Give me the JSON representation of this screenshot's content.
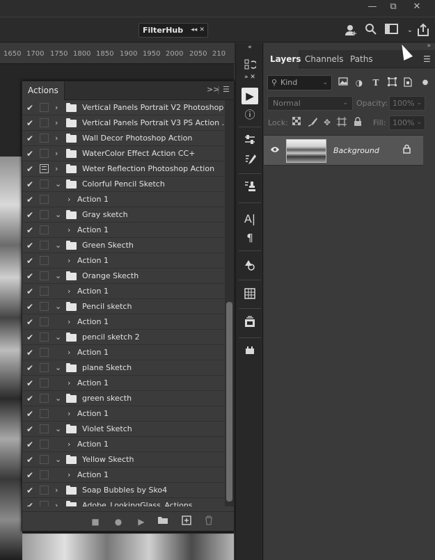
{
  "window": {
    "minimize": "—",
    "restore": "⧉",
    "close": "✕"
  },
  "optionsbar": {
    "filterhub": {
      "label": "FilterHub",
      "controls": "◂◂ ✕"
    },
    "icons": [
      "person-add-icon",
      "search-icon",
      "workspace-icon",
      "share-icon"
    ]
  },
  "ruler": {
    "ticks": [
      "1650",
      "1700",
      "1750",
      "1800",
      "1850",
      "1900",
      "1950",
      "2000",
      "2050",
      "210"
    ]
  },
  "actions": {
    "tab": "Actions",
    "header_icons": {
      "collapse": ">>",
      "menu": "☰"
    },
    "rows": [
      {
        "type": "set",
        "expanded": false,
        "dialog": false,
        "label": "Vertical Panels Portrait V2 Photoshop ..."
      },
      {
        "type": "set",
        "expanded": false,
        "dialog": false,
        "label": "Vertical Panels Portrait V3 PS Action ..."
      },
      {
        "type": "set",
        "expanded": false,
        "dialog": false,
        "label": "Wall Decor Photoshop Action"
      },
      {
        "type": "set",
        "expanded": false,
        "dialog": false,
        "label": "WaterColor Effect Action CC+"
      },
      {
        "type": "set",
        "expanded": false,
        "dialog": true,
        "label": "Weter Reflection Photoshop Action"
      },
      {
        "type": "set",
        "expanded": true,
        "dialog": false,
        "label": "Colorful Pencil Sketch"
      },
      {
        "type": "action",
        "label": "Action 1"
      },
      {
        "type": "set",
        "expanded": true,
        "dialog": false,
        "label": "Gray sketch"
      },
      {
        "type": "action",
        "label": "Action 1"
      },
      {
        "type": "set",
        "expanded": true,
        "dialog": false,
        "label": "Green Skecth"
      },
      {
        "type": "action",
        "label": "Action 1"
      },
      {
        "type": "set",
        "expanded": true,
        "dialog": false,
        "label": "Orange Skecth"
      },
      {
        "type": "action",
        "label": "Action 1"
      },
      {
        "type": "set",
        "expanded": true,
        "dialog": false,
        "label": "Pencil sketch"
      },
      {
        "type": "action",
        "label": "Action 1"
      },
      {
        "type": "set",
        "expanded": true,
        "dialog": false,
        "label": "pencil sketch 2"
      },
      {
        "type": "action",
        "label": "Action 1"
      },
      {
        "type": "set",
        "expanded": true,
        "dialog": false,
        "label": "plane Sketch"
      },
      {
        "type": "action",
        "label": "Action 1"
      },
      {
        "type": "set",
        "expanded": true,
        "dialog": false,
        "label": "green skecth"
      },
      {
        "type": "action",
        "label": "Action 1"
      },
      {
        "type": "set",
        "expanded": true,
        "dialog": false,
        "label": "Violet Sketch"
      },
      {
        "type": "action",
        "label": "Action 1"
      },
      {
        "type": "set",
        "expanded": true,
        "dialog": false,
        "label": "Yellow Skecth"
      },
      {
        "type": "action",
        "label": "Action 1"
      },
      {
        "type": "set",
        "expanded": false,
        "dialog": false,
        "label": "Soap Bubbles by Sko4"
      },
      {
        "type": "set",
        "expanded": false,
        "dialog": false,
        "label": "Adobe_LookingGlass_Actions"
      }
    ],
    "footer_icons": [
      "stop-icon",
      "record-icon",
      "play-icon",
      "folder-icon",
      "new-action-icon",
      "trash-icon"
    ]
  },
  "toolstrip": {
    "icons": [
      "history-icon",
      "play-icon",
      "info-icon",
      "adjustments-icon",
      "brush-settings-icon",
      "stamp-icon",
      "character-icon",
      "paragraph-icon",
      "shapes-icon",
      "glyphs-icon",
      "libraries-icon",
      "plugins-icon"
    ]
  },
  "layers": {
    "tabs": [
      "Layers",
      "Channels",
      "Paths"
    ],
    "active_tab": "Layers",
    "filter": {
      "placeholder": "Kind"
    },
    "blend_mode": "Normal",
    "opacity_label": "Opacity:",
    "opacity_value": "100%",
    "lock_label": "Lock:",
    "fill_label": "Fill:",
    "fill_value": "100%",
    "items": [
      {
        "name": "Background",
        "visible": true,
        "locked": true
      }
    ]
  },
  "colors": {
    "panel": "#3b3b3b",
    "selected_layer": "#555555",
    "accent": "#e6e6e6"
  }
}
